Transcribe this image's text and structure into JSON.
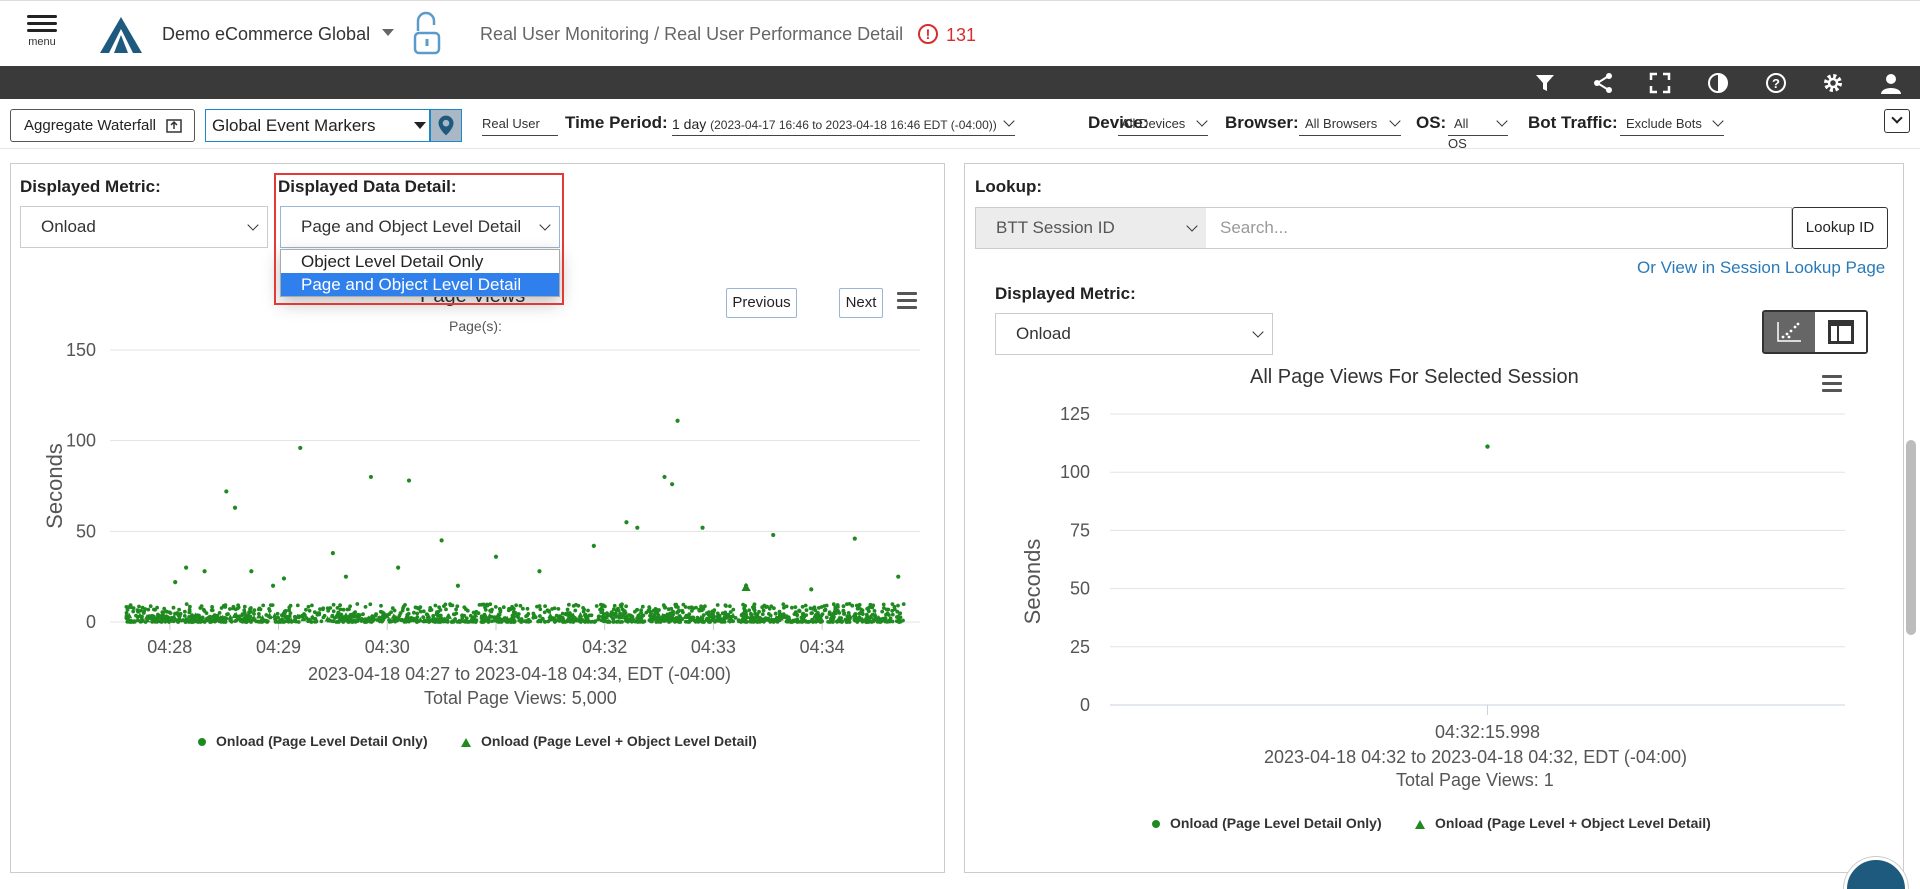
{
  "header": {
    "menu_label": "menu",
    "app_name": "Demo eCommerce Global",
    "breadcrumb": "Real User Monitoring / Real User Performance Detail",
    "alert_count": "131",
    "alert_glyph": "!"
  },
  "toolbar_icons": [
    "filter-icon",
    "share-icon",
    "fullscreen-icon",
    "contrast-icon",
    "help-icon",
    "gear-icon",
    "user-icon"
  ],
  "filters": {
    "aggregate_waterfall": "Aggregate Waterfall",
    "event_markers": "Global Event Markers",
    "data_source": "Real User",
    "time_period_label": "Time Period:",
    "time_period_value": "1 day",
    "time_period_range": "(2023-04-17 16:46 to 2023-04-18 16:46 EDT (-04:00))",
    "device_label": "Device:",
    "device_value": "All Devices",
    "browser_label": "Browser:",
    "browser_value": "All Browsers",
    "os_label": "OS:",
    "os_value": "All OS",
    "bot_label": "Bot Traffic:",
    "bot_value": "Exclude Bots"
  },
  "left_panel": {
    "metric_label": "Displayed Metric:",
    "metric_value": "Onload",
    "detail_label": "Displayed Data Detail:",
    "detail_value": "Page and Object Level Detail",
    "detail_options": [
      "Object Level Detail Only",
      "Page and Object Level Detail"
    ],
    "chart_title": "Page Views",
    "chart_subtitle": "Page(s):",
    "prev_label": "Previous",
    "next_label": "Next",
    "footer_range": "2023-04-18 04:27 to 2023-04-18 04:34, EDT (-04:00)",
    "footer_total": "Total Page Views: 5,000",
    "legend_page": "Onload (Page Level Detail Only)",
    "legend_object": "Onload (Page Level + Object Level Detail)"
  },
  "right_panel": {
    "lookup_label": "Lookup:",
    "lookup_type": "BTT Session ID",
    "search_placeholder": "Search...",
    "lookup_button": "Lookup ID",
    "session_link": "Or View in Session Lookup Page",
    "metric_label": "Displayed Metric:",
    "metric_value": "Onload",
    "chart_title": "All Page Views For Selected Session",
    "footer_range": "2023-04-18 04:32 to 2023-04-18 04:32, EDT (-04:00)",
    "footer_total": "Total Page Views: 1",
    "legend_page": "Onload (Page Level Detail Only)",
    "legend_object": "Onload (Page Level + Object Level Detail)"
  },
  "colors": {
    "series": "#1f8a1f",
    "highlight": "#e53935",
    "selected_option": "#2f80ed",
    "alert": "#d32f2f"
  },
  "chart_data": [
    {
      "type": "scatter",
      "title": "Page Views",
      "ylabel": "Seconds",
      "x_ticks": [
        "04:28",
        "04:29",
        "04:30",
        "04:31",
        "04:32",
        "04:33",
        "04:34"
      ],
      "y_ticks": [
        0,
        50,
        100,
        150
      ],
      "ylim": [
        0,
        150
      ],
      "series": [
        {
          "name": "Onload (Page Level Detail Only)",
          "marker": "circle",
          "x_minutes": [
            0.05,
            0.15,
            0.32,
            0.52,
            0.75,
            0.95,
            1.2,
            1.5,
            1.62,
            1.85,
            2.2,
            2.5,
            2.65,
            3.0,
            3.4,
            3.9,
            4.3,
            4.55,
            4.62,
            4.67,
            4.9,
            5.3,
            5.55,
            5.9,
            6.3,
            6.7,
            4.2,
            2.1,
            0.6,
            1.05
          ],
          "values": [
            22,
            30,
            28,
            72,
            28,
            20,
            96,
            38,
            25,
            80,
            78,
            45,
            20,
            36,
            28,
            42,
            52,
            80,
            76,
            111,
            52,
            20,
            48,
            18,
            46,
            25,
            55,
            30,
            63,
            24
          ]
        },
        {
          "name": "Onload (Page Level + Object Level Detail)",
          "marker": "triangle",
          "x_minutes": [
            5.3
          ],
          "values": [
            19
          ]
        }
      ],
      "dense_band": {
        "count": 5000,
        "value_range": [
          0,
          10
        ]
      },
      "x_range_minutes": [
        -0.55,
        6.9
      ]
    },
    {
      "type": "scatter",
      "title": "All Page Views For Selected Session",
      "ylabel": "Seconds",
      "x_ticks": [
        "04:32:15.998"
      ],
      "y_ticks": [
        0,
        25,
        50,
        75,
        100,
        125
      ],
      "ylim": [
        0,
        125
      ],
      "series": [
        {
          "name": "Onload (Page Level Detail Only)",
          "marker": "circle",
          "values": [
            111
          ]
        }
      ]
    }
  ]
}
